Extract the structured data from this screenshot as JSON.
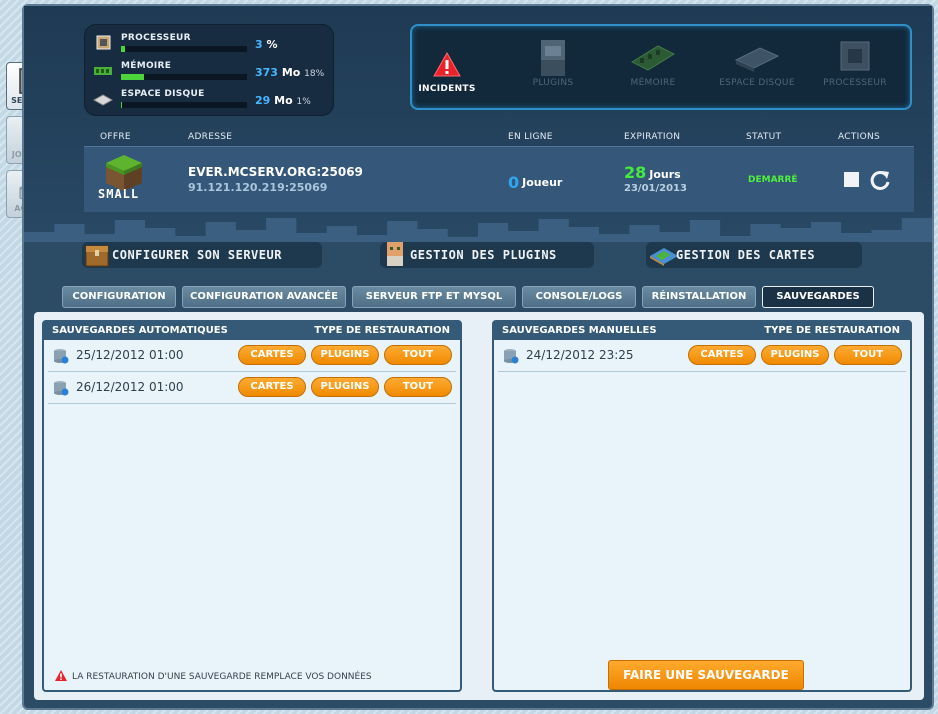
{
  "nav": [
    {
      "label": "SERVEUR",
      "active": true
    },
    {
      "label": "JOUEURS",
      "active": false
    },
    {
      "label": "ACHATS",
      "active": false
    }
  ],
  "stats": {
    "cpu": {
      "label": "PROCESSEUR",
      "value": "3",
      "unit": "%",
      "pct": "",
      "fill": 0.03
    },
    "mem": {
      "label": "MÉMOIRE",
      "value": "373",
      "unit": "Mo",
      "pct": "18%",
      "fill": 0.18
    },
    "disk": {
      "label": "ESPACE DISQUE",
      "value": "29",
      "unit": "Mo",
      "pct": "1%",
      "fill": 0.01
    }
  },
  "alerts": [
    {
      "label": "INCIDENTS",
      "active": true
    },
    {
      "label": "PLUGINS",
      "active": false
    },
    {
      "label": "MÉMOIRE",
      "active": false
    },
    {
      "label": "ESPACE DISQUE",
      "active": false
    },
    {
      "label": "PROCESSEUR",
      "active": false
    }
  ],
  "server": {
    "headers": {
      "offer": "OFFRE",
      "address": "ADRESSE",
      "online": "EN LIGNE",
      "expiration": "EXPIRATION",
      "status": "STATUT",
      "actions": "ACTIONS"
    },
    "offer": "SMALL",
    "address": "EVER.MCSERV.ORG:25069",
    "ip": "91.121.120.219:25069",
    "online_count": "0",
    "online_unit": "Joueur",
    "days": "28",
    "days_unit": "Jours",
    "expiry_date": "23/01/2013",
    "status": "DEMARRÉ"
  },
  "big_buttons": [
    "CONFIGURER SON SERVEUR",
    "GESTION DES PLUGINS",
    "GESTION DES CARTES"
  ],
  "tabs": [
    "CONFIGURATION",
    "CONFIGURATION AVANCÉE",
    "SERVEUR FTP ET MYSQL",
    "CONSOLE/LOGS",
    "RÉINSTALLATION",
    "SAUVEGARDES"
  ],
  "auto": {
    "title": "SAUVEGARDES AUTOMATIQUES",
    "restore_type": "TYPE DE RESTAURATION",
    "rows": [
      "25/12/2012 01:00",
      "26/12/2012 01:00"
    ],
    "warning": "LA RESTAURATION D'UNE SAUVEGARDE REMPLACE VOS DONNÉES"
  },
  "manual": {
    "title": "SAUVEGARDES MANUELLES",
    "restore_type": "TYPE DE RESTAURATION",
    "rows": [
      "24/12/2012 23:25"
    ],
    "save_button": "FAIRE UNE SAUVEGARDE"
  },
  "restore_buttons": {
    "maps": "CARTES",
    "plugins": "PLUGINS",
    "all": "TOUT"
  },
  "colors": {
    "accent_orange": "#f39200",
    "panel_blue": "#2c4b65",
    "status_green": "#4ff03c",
    "online_blue": "#2ea7f3"
  }
}
